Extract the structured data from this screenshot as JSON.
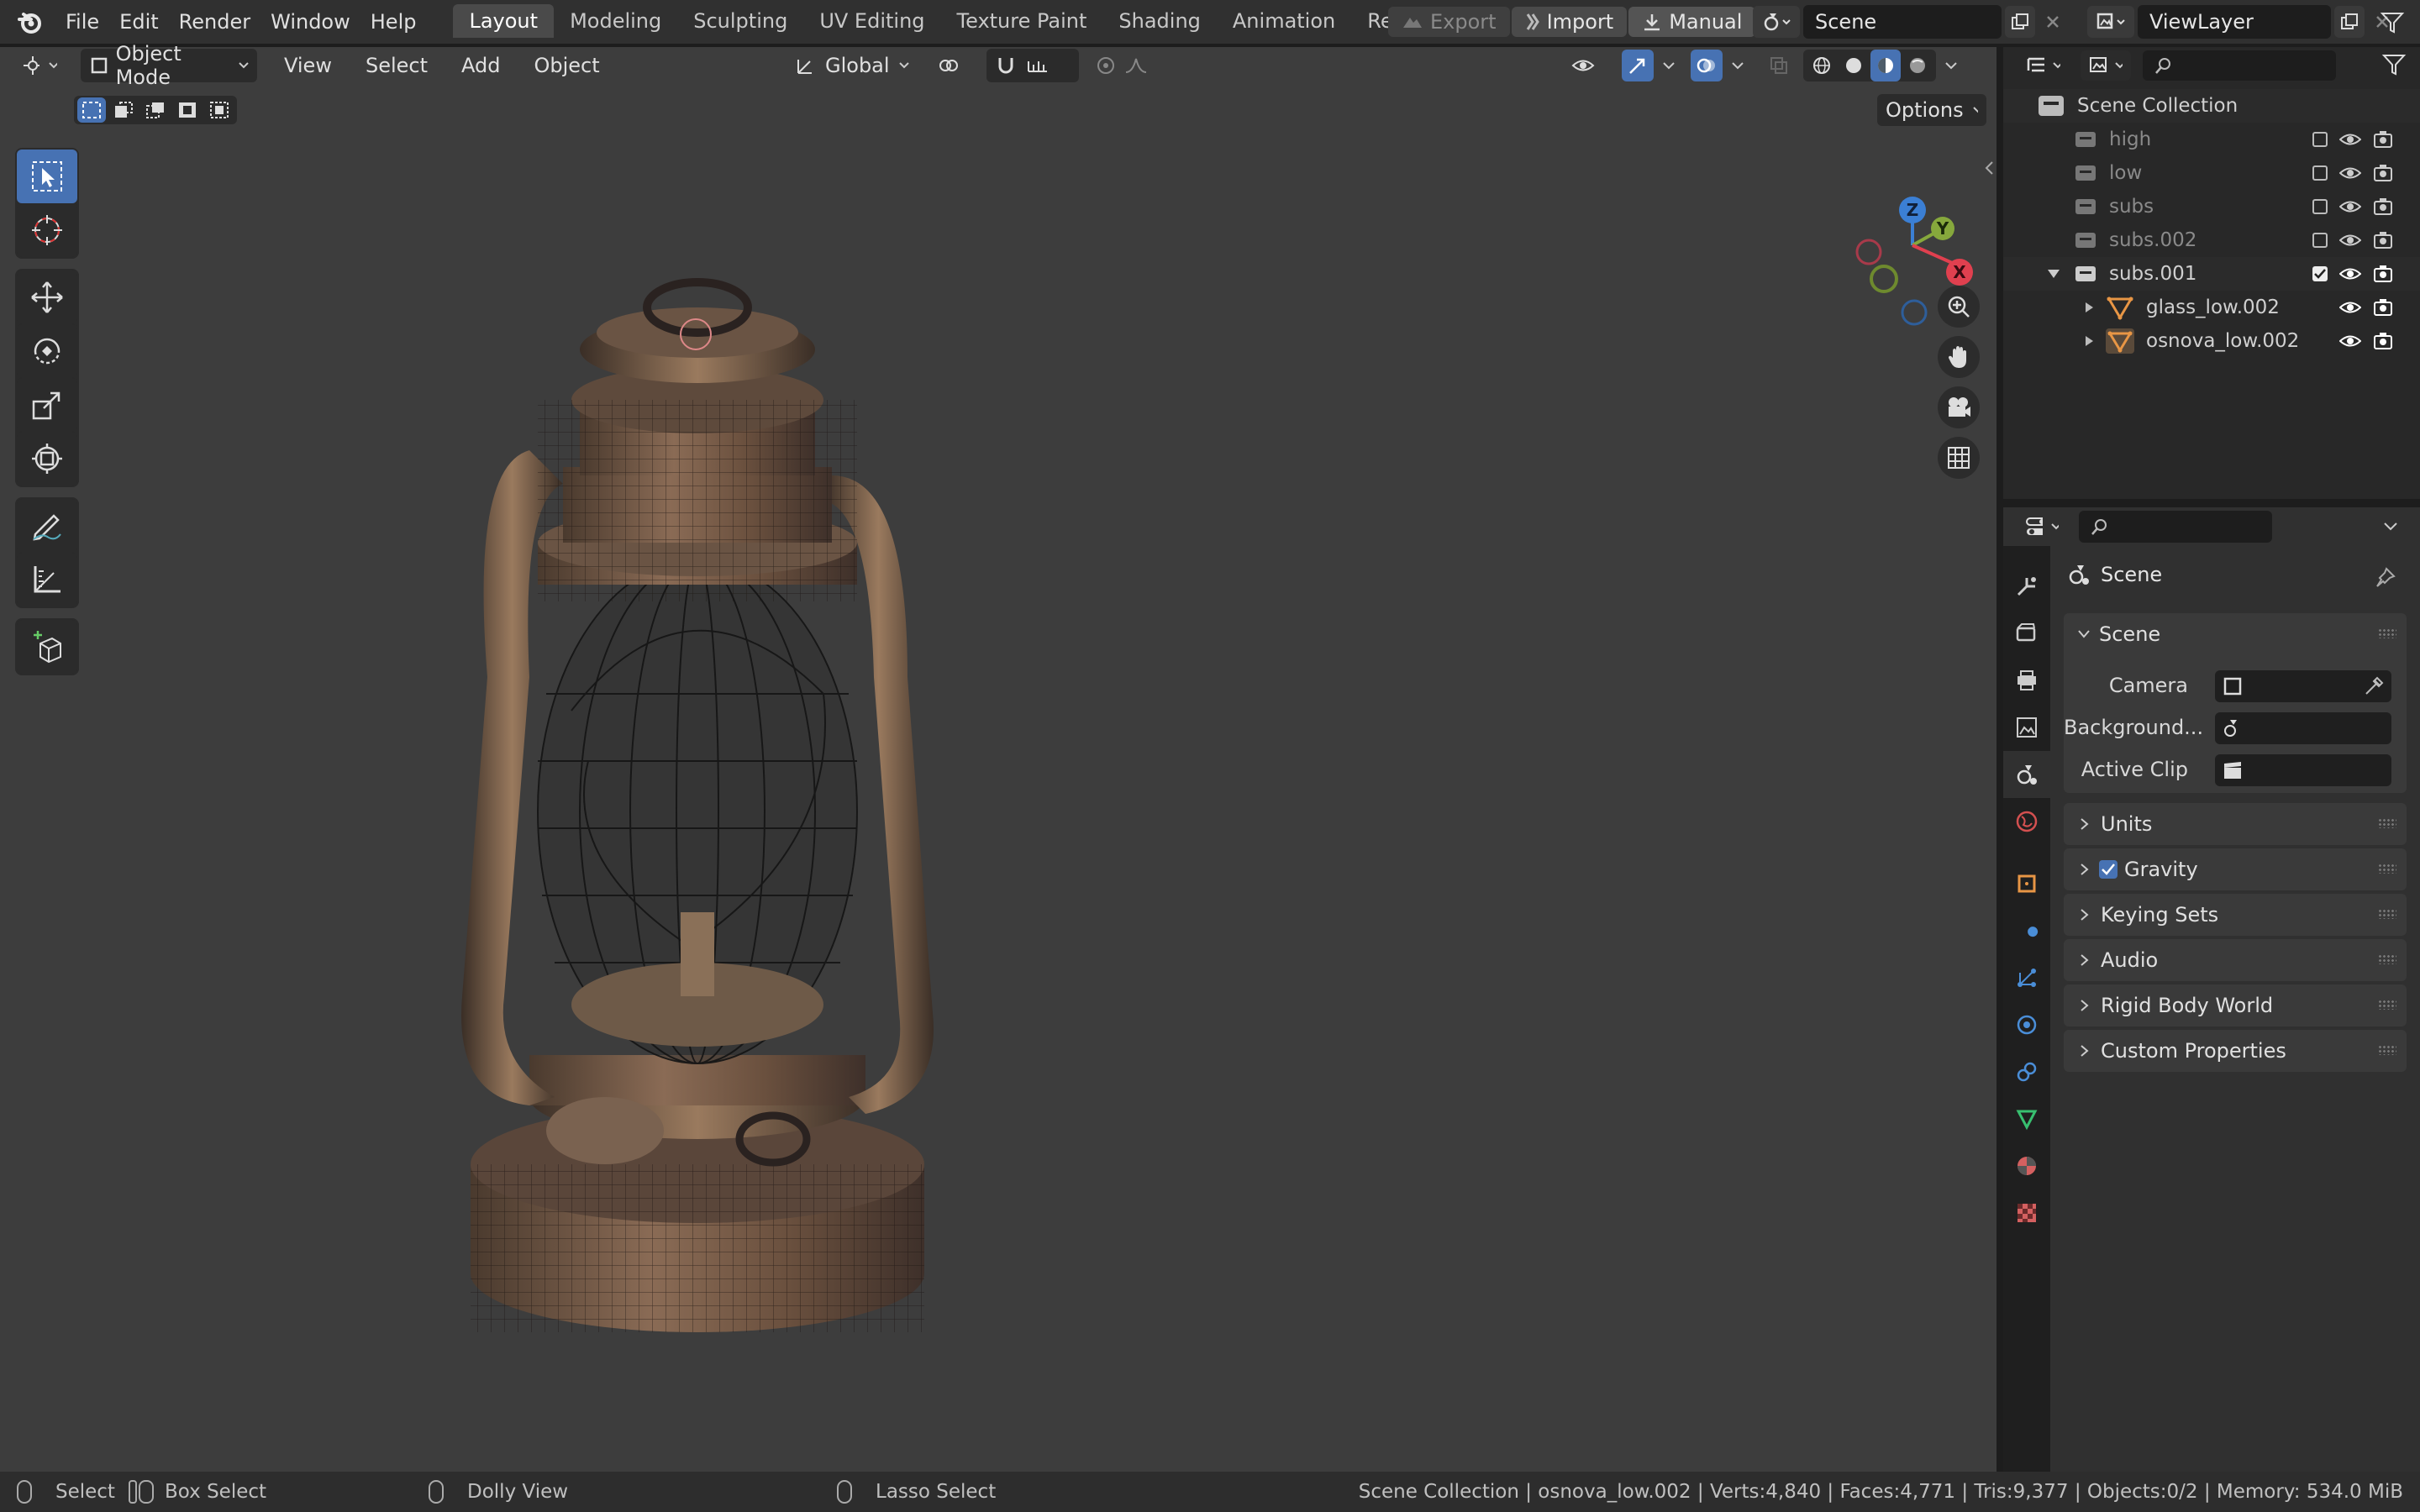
{
  "topbar": {
    "menus": [
      "File",
      "Edit",
      "Render",
      "Window",
      "Help"
    ],
    "workspaces": [
      "Layout",
      "Modeling",
      "Sculpting",
      "UV Editing",
      "Texture Paint",
      "Shading",
      "Animation",
      "Rendering"
    ],
    "active_workspace": "Layout",
    "export_label": "Export",
    "import_label": "Import",
    "manual_label": "Manual",
    "scene_name": "Scene",
    "viewlayer_name": "ViewLayer"
  },
  "viewport": {
    "mode": "Object Mode",
    "menus": [
      "View",
      "Select",
      "Add",
      "Object"
    ],
    "transform_orientation": "Global",
    "options_label": "Options",
    "gizmo": {
      "z": "Z",
      "y": "Y",
      "x": "X"
    }
  },
  "outliner": {
    "root": "Scene Collection",
    "rows": [
      {
        "name": "high",
        "dim": true
      },
      {
        "name": "low",
        "dim": true
      },
      {
        "name": "subs",
        "dim": true
      },
      {
        "name": "subs.002",
        "dim": true
      },
      {
        "name": "subs.001",
        "dim": false
      },
      {
        "name": "glass_low.002",
        "dim": false
      },
      {
        "name": "osnova_low.002",
        "dim": false
      }
    ]
  },
  "properties": {
    "context_title": "Scene",
    "scene_panel": "Scene",
    "camera_label": "Camera",
    "background_label": "Background...",
    "active_clip_label": "Active Clip",
    "panels": [
      "Units",
      "Gravity",
      "Keying Sets",
      "Audio",
      "Rigid Body World",
      "Custom Properties"
    ],
    "gravity_checked": true
  },
  "statusbar": {
    "select": "Select",
    "box_select": "Box Select",
    "dolly_view": "Dolly View",
    "lasso_select": "Lasso Select",
    "stats": "Scene Collection | osnova_low.002 | Verts:4,840 | Faces:4,771 | Tris:9,377 | Objects:0/2 | Memory: 534.0 MiB"
  },
  "colors": {
    "accent_blue": "#4772b3",
    "axis_x": "#e0404f",
    "axis_y": "#86a83c",
    "axis_z": "#3b7fd4",
    "object_orange": "#e89645"
  }
}
